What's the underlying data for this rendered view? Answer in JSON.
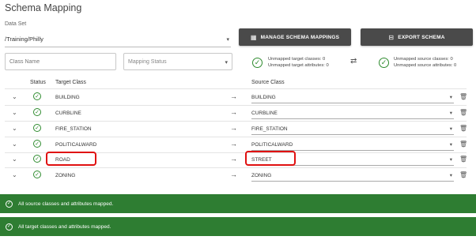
{
  "title": "Schema Mapping",
  "dataset": {
    "label": "Data Set",
    "value": "/Training/Philly"
  },
  "buttons": {
    "manage": "MANAGE SCHEMA MAPPINGS",
    "export": "EXPORT SCHEMA"
  },
  "filters": {
    "class_name_placeholder": "Class Name",
    "mapping_status_placeholder": "Mapping Status"
  },
  "unmapped_target": {
    "classes": "Unmapped target classes: 0",
    "attributes": "Unmapped target attributes: 0"
  },
  "unmapped_source": {
    "classes": "Unmapped source classes: 0",
    "attributes": "Unmapped source attributes: 0"
  },
  "table": {
    "headers": {
      "status": "Status",
      "target": "Target Class",
      "source": "Source Class"
    },
    "rows": [
      {
        "target": "BUILDING",
        "source": "BUILDING",
        "highlighted": false
      },
      {
        "target": "CURBLINE",
        "source": "CURBLINE",
        "highlighted": false
      },
      {
        "target": "FIRE_STATION",
        "source": "FIRE_STATION",
        "highlighted": false
      },
      {
        "target": "POLITICALWARD",
        "source": "POLITICALWARD",
        "highlighted": false
      },
      {
        "target": "ROAD",
        "source": "STREET",
        "highlighted": true
      },
      {
        "target": "ZONING",
        "source": "ZONING",
        "highlighted": false
      }
    ]
  },
  "banners": {
    "source": "All source classes and attributes mapped.",
    "target": "All target classes and attributes mapped."
  },
  "colors": {
    "success_green": "#2e7d32",
    "check_green": "#2e8b2e",
    "button_dark": "#4a4a4a",
    "highlight_red": "#e01010"
  },
  "icons": {
    "expand": "chevron-down-icon",
    "status": "check-circle-icon",
    "arrow": "arrow-right-icon",
    "delete": "trash-icon",
    "swap": "swap-arrows-icon",
    "manage": "table-icon",
    "export": "export-icon"
  }
}
